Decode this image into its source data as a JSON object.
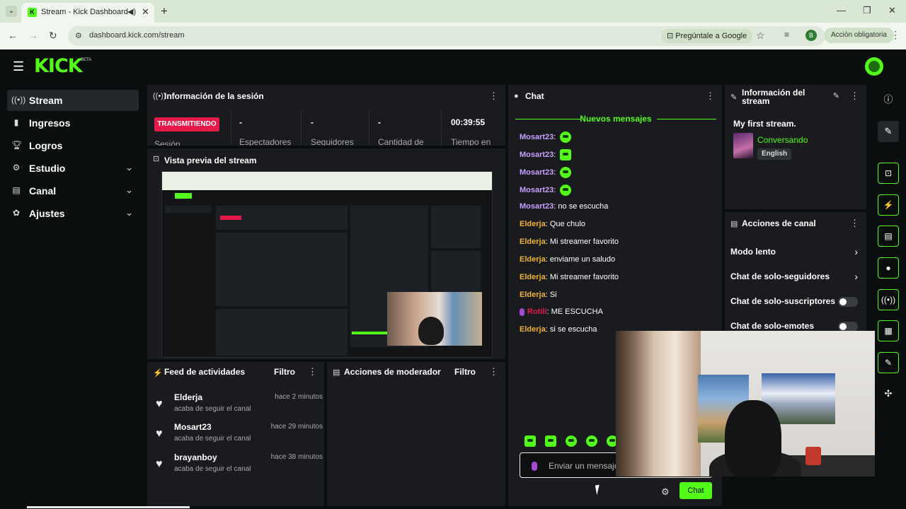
{
  "browser": {
    "tab_title": "Stream - Kick Dashboard",
    "url": "dashboard.kick.com/stream",
    "google_button": "Pregúntale a Google",
    "profile_initial": "B",
    "update_button": "Acción obligatoria"
  },
  "header": {
    "logo": "KICK",
    "logo_badge": "BETA"
  },
  "sidebar": {
    "items": [
      {
        "label": "Stream",
        "icon": "broadcast-icon"
      },
      {
        "label": "Ingresos",
        "icon": "chart-icon"
      },
      {
        "label": "Logros",
        "icon": "trophy-icon"
      },
      {
        "label": "Estudio",
        "icon": "sliders-icon"
      },
      {
        "label": "Canal",
        "icon": "layers-icon"
      },
      {
        "label": "Ajustes",
        "icon": "gear-icon"
      }
    ]
  },
  "session": {
    "title": "Información de la sesión",
    "live_badge": "TRANSMITIENDO",
    "session_label": "Sesión",
    "stats": [
      {
        "value": "-",
        "label": "Espectadores"
      },
      {
        "value": "-",
        "label": "Seguidores"
      },
      {
        "value": "-",
        "label": "Cantidad de"
      },
      {
        "value": "00:39:55",
        "label": "Tiempo en"
      }
    ]
  },
  "preview": {
    "title": "Vista previa del stream"
  },
  "activity": {
    "title": "Feed de actividades",
    "filter": "Filtro",
    "items": [
      {
        "name": "Elderja",
        "action": "acaba de seguir el canal",
        "time": "hace 2 minutos"
      },
      {
        "name": "Mosart23",
        "action": "acaba de seguir el canal",
        "time": "hace 29 minutos"
      },
      {
        "name": "brayanboy",
        "action": "acaba de seguir el canal",
        "time": "hace 38 minutos"
      }
    ]
  },
  "moderator": {
    "title": "Acciones de moderador",
    "filter": "Filtro"
  },
  "chat": {
    "title": "Chat",
    "new_messages": "Nuevos mensajes",
    "messages": [
      {
        "user": "Mosart23",
        "color": "#c7a0ff",
        "text": "",
        "emote": true
      },
      {
        "user": "Mosart23",
        "color": "#c7a0ff",
        "text": "",
        "emote": true
      },
      {
        "user": "Mosart23",
        "color": "#c7a0ff",
        "text": "",
        "emote": true
      },
      {
        "user": "Mosart23",
        "color": "#c7a0ff",
        "text": "",
        "emote": true
      },
      {
        "user": "Mosart23",
        "color": "#c7a0ff",
        "text": "no se escucha"
      },
      {
        "user": "Elderja",
        "color": "#f0b232",
        "text": "Que chulo"
      },
      {
        "user": "Elderja",
        "color": "#f0b232",
        "text": "Mi streamer favorito"
      },
      {
        "user": "Elderja",
        "color": "#f0b232",
        "text": "enviame un saludo"
      },
      {
        "user": "Elderja",
        "color": "#f0b232",
        "text": "Mi streamer favorito"
      },
      {
        "user": "Elderja",
        "color": "#f0b232",
        "text": "Si"
      },
      {
        "user": "Rotili",
        "color": "#e61a4a",
        "text": "ME ESCUCHA",
        "mic": true
      },
      {
        "user": "Elderja",
        "color": "#f0b232",
        "text": "si se escucha"
      }
    ],
    "input_placeholder": "Enviar un mensaje",
    "send_button": "Chat"
  },
  "stream_info": {
    "title": "Información del stream",
    "stream_title": "My first stream.",
    "category": "Conversando",
    "language_tag": "English"
  },
  "channel_actions": {
    "title": "Acciones de canal",
    "items": [
      {
        "label": "Modo lento",
        "type": "link"
      },
      {
        "label": "Chat de solo-seguidores",
        "type": "link"
      },
      {
        "label": "Chat de solo-suscriptores",
        "type": "toggle",
        "on": false
      },
      {
        "label": "Chat de solo-emotes",
        "type": "toggle",
        "on": false
      }
    ]
  },
  "colors": {
    "accent": "#53fc18",
    "live": "#e61a4a",
    "panel": "#191b1f",
    "background": "#0b0e0f"
  }
}
